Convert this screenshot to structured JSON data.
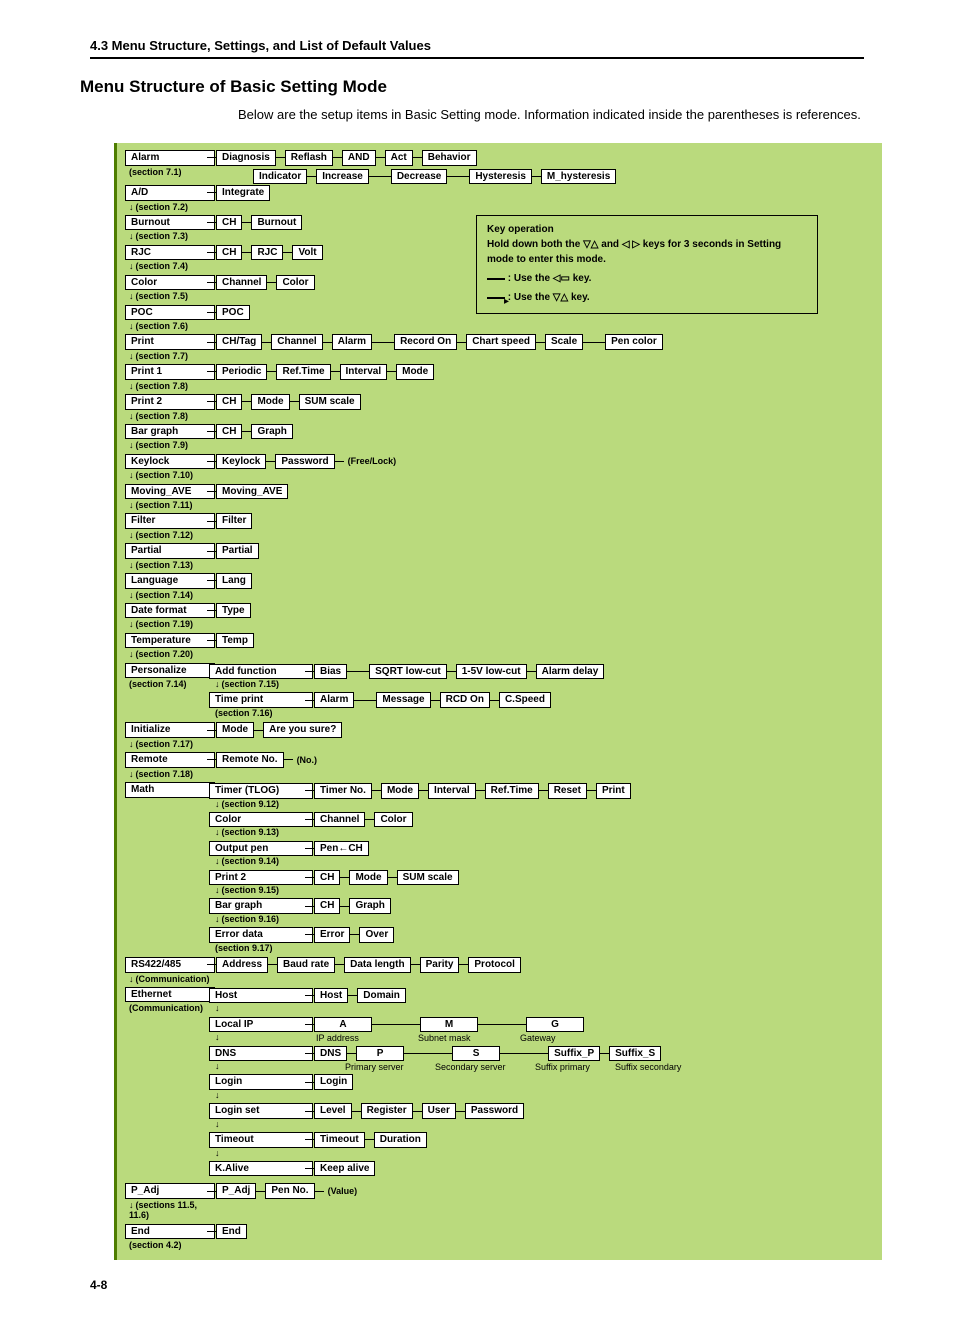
{
  "header": "4.3  Menu Structure, Settings, and List of Default Values",
  "title": "Menu Structure of Basic Setting Mode",
  "intro": "Below are the setup items in Basic Setting mode.  Information indicated inside the parentheses is references.",
  "page_num": "4-8",
  "keybox": {
    "title": "Key operation",
    "line1a": "Hold down both the ",
    "line1b": " and ",
    "line1c": " keys for 3 seconds in Setting mode to enter this mode.",
    "glyph_updown": "▽△",
    "glyph_leftright": "◁ ▷",
    "row2a": "  :  Use the ",
    "row2b": "  key.",
    "glyph_menu": "◁▭",
    "row3a": ":  Use the ",
    "row3b": " key."
  },
  "L": {
    "alarm": "Alarm",
    "alarm_s": "(section 7.1)",
    "ad": "A/D",
    "ad_s": "(section 7.2)",
    "burnout": "Burnout",
    "burnout_s": "(section 7.3)",
    "rjc": "RJC",
    "rjc_s": "(section 7.4)",
    "color": "Color",
    "color_s": "(section 7.5)",
    "poc": "POC",
    "poc_s": "(section 7.6)",
    "print": "Print",
    "print_s": "(section 7.7)",
    "print1": "Print 1",
    "print1_s": "(section 7.8)",
    "print2": "Print 2",
    "print2_s": "(section 7.8)",
    "bar": "Bar graph",
    "bar_s": "(section 7.9)",
    "keylock": "Keylock",
    "keylock_s": "(section 7.10)",
    "mave": "Moving_AVE",
    "mave_s": "(section 7.11)",
    "filter": "Filter",
    "filter_s": "(section 7.12)",
    "partial": "Partial",
    "partial_s": "(section 7.13)",
    "lang": "Language",
    "lang_s": "(section 7.14)",
    "datef": "Date format",
    "datef_s": "(section 7.19)",
    "temp": "Temperature",
    "temp_s": "(section 7.20)",
    "pers": "Personalize",
    "pers_s": "(section 7.14)",
    "init": "Initialize",
    "init_s": "(section 7.17)",
    "remote": "Remote",
    "remote_s": "(section 7.18)",
    "math": "Math",
    "rs": "RS422/485",
    "rs_s": "(Communication)",
    "eth": "Ethernet",
    "eth_s": "(Communication)",
    "padj": "P_Adj",
    "padj_s": "(sections 11.5, 11.6)",
    "end": "End",
    "end_s": "(section 4.2)"
  },
  "R": {
    "alarm1": [
      "Diagnosis",
      "Reflash",
      "AND",
      "Act",
      "Behavior"
    ],
    "alarm2": [
      "Indicator",
      "Increase",
      "Decrease",
      "Hysteresis",
      "M_hysteresis"
    ],
    "ad": [
      "Integrate"
    ],
    "burnout": [
      "CH",
      "Burnout"
    ],
    "rjc": [
      "CH",
      "RJC",
      "Volt"
    ],
    "color": [
      "Channel",
      "Color"
    ],
    "poc": [
      "POC"
    ],
    "print": [
      "CH/Tag",
      "Channel",
      "Alarm",
      "Record On",
      "Chart speed",
      "Scale",
      "Pen color"
    ],
    "print1": [
      "Periodic",
      "Ref.Time",
      "Interval",
      "Mode"
    ],
    "print2": [
      "CH",
      "Mode",
      "SUM scale"
    ],
    "bar": [
      "CH",
      "Graph"
    ],
    "keylock": [
      "Keylock",
      "Password",
      "(Free/Lock)"
    ],
    "mave": [
      "Moving_AVE"
    ],
    "filter": [
      "Filter"
    ],
    "partial": [
      "Partial"
    ],
    "lang": [
      "Lang"
    ],
    "datef": [
      "Type"
    ],
    "temp": [
      "Temp"
    ],
    "pers_addfn": "Add function",
    "pers_addfn_s": "(section 7.15)",
    "pers_add": [
      "Bias",
      "SQRT low-cut",
      "1-5V low-cut",
      "Alarm delay"
    ],
    "pers_tp": "Time print",
    "pers_tp_s": "(section 7.16)",
    "pers_time": [
      "Alarm",
      "Message",
      "RCD On",
      "C.Speed"
    ],
    "init": [
      "Mode",
      "Are you sure?"
    ],
    "remote": [
      "Remote No.",
      "(No.)"
    ],
    "math_timer": "Timer (TLOG)",
    "math_timer_s": "(section 9.12)",
    "math_timer_r": [
      "Timer No.",
      "Mode",
      "Interval",
      "Ref.Time",
      "Reset",
      "Print"
    ],
    "math_color": "Color",
    "math_color_s": "(section 9.13)",
    "math_color_r": [
      "Channel",
      "Color"
    ],
    "math_open": "Output pen",
    "math_open_s": "(section 9.14)",
    "math_open_r": [
      "Pen←CH"
    ],
    "math_p2": "Print 2",
    "math_p2_s": "(section 9.15)",
    "math_p2_r": [
      "CH",
      "Mode",
      "SUM scale"
    ],
    "math_bar": "Bar graph",
    "math_bar_s": "(section 9.16)",
    "math_bar_r": [
      "CH",
      "Graph"
    ],
    "math_err": "Error data",
    "math_err_s": "(section 9.17)",
    "math_err_r": [
      "Error",
      "Over"
    ],
    "rs": [
      "Address",
      "Baud rate",
      "Data length",
      "Parity",
      "Protocol"
    ],
    "eth_host": "Host",
    "eth_host_r": [
      "Host",
      "Domain"
    ],
    "eth_ip": "Local IP",
    "eth_ip_r": [
      "A",
      "M",
      "G"
    ],
    "eth_ip_n": [
      "IP address",
      "Subnet mask",
      "Gateway"
    ],
    "eth_dns": "DNS",
    "eth_dns_r": [
      "DNS",
      "P",
      "S",
      "Suffix_P",
      "Suffix_S"
    ],
    "eth_dns_n": [
      "Primary server",
      "Secondary server",
      "Suffix primary",
      "Suffix secondary"
    ],
    "eth_login": "Login",
    "eth_login_r": [
      "Login"
    ],
    "eth_lset": "Login set",
    "eth_lset_r": [
      "Level",
      "Register",
      "User",
      "Password"
    ],
    "eth_to": "Timeout",
    "eth_to_r": [
      "Timeout",
      "Duration"
    ],
    "eth_ka": "K.Alive",
    "eth_ka_r": [
      "Keep alive"
    ],
    "padj": [
      "P_Adj",
      "Pen No.",
      "(Value)"
    ],
    "end": [
      "End"
    ]
  }
}
